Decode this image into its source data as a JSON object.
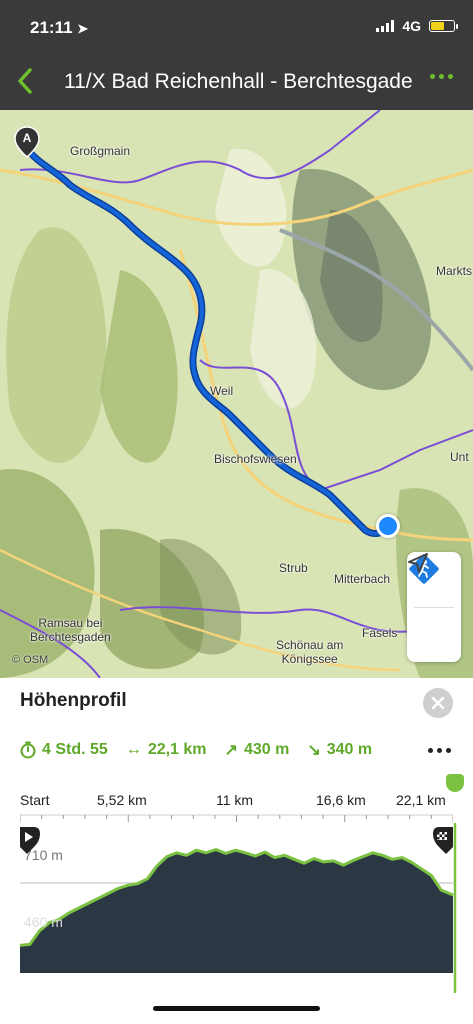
{
  "status": {
    "time": "21:11",
    "network": "4G"
  },
  "header": {
    "title": "11/X Bad Reichenhall - Berchtesgaden"
  },
  "map": {
    "places": {
      "grossgmain": "Großgmain",
      "markts": "Markts",
      "weil": "Weil",
      "bischofswiesen": "Bischofswiesen",
      "unt": "Unt",
      "strub": "Strub",
      "mitterbach": "Mitterbach",
      "ramsau": "Ramsau bei\nBerchtesgaden",
      "fasels": "Fasels",
      "schoenau": "Schönau am\nKönigssee"
    },
    "start_marker": "A",
    "attribution": "© OSM",
    "colors": {
      "route": "#1565d8",
      "border": "#7b4ed6",
      "position": "#1e88ff"
    }
  },
  "profile_panel": {
    "title": "Höhenprofil",
    "stats": {
      "duration": "4 Std. 55",
      "distance": "22,1 km",
      "ascent": "430 m",
      "descent": "340 m"
    },
    "x_labels": [
      "Start",
      "5,52 km",
      "11 km",
      "16,6 km",
      "22,1 km"
    ],
    "y_labels": {
      "top": "710 m",
      "bottom": "460 m"
    },
    "accent_color": "#7cc242"
  },
  "chart_data": {
    "type": "area",
    "title": "Höhenprofil",
    "xlabel": "",
    "ylabel": "",
    "x": [
      0,
      0.5,
      1.0,
      1.5,
      2.0,
      2.5,
      3.0,
      3.5,
      4.0,
      4.5,
      5.0,
      5.5,
      6.0,
      6.5,
      7.0,
      7.5,
      8.0,
      8.5,
      9.0,
      9.5,
      10.0,
      10.5,
      11.0,
      11.5,
      12.0,
      12.5,
      13.0,
      13.5,
      14.0,
      14.5,
      15.0,
      15.5,
      16.0,
      16.5,
      17.0,
      17.5,
      18.0,
      18.5,
      19.0,
      19.5,
      20.0,
      20.5,
      21.0,
      21.5,
      22.1
    ],
    "y": [
      475,
      478,
      520,
      545,
      555,
      575,
      590,
      605,
      620,
      635,
      650,
      660,
      665,
      680,
      720,
      748,
      760,
      752,
      768,
      760,
      770,
      758,
      768,
      760,
      750,
      762,
      745,
      752,
      740,
      728,
      742,
      732,
      735,
      722,
      736,
      748,
      760,
      752,
      740,
      745,
      730,
      710,
      690,
      645,
      630
    ],
    "ylim": [
      390,
      790
    ],
    "xlim": [
      0,
      22.1
    ],
    "ticks_x": [
      "Start",
      "5,52 km",
      "11 km",
      "16,6 km",
      "22,1 km"
    ],
    "ticks_y": [
      "710 m",
      "460 m"
    ],
    "grid": true
  }
}
